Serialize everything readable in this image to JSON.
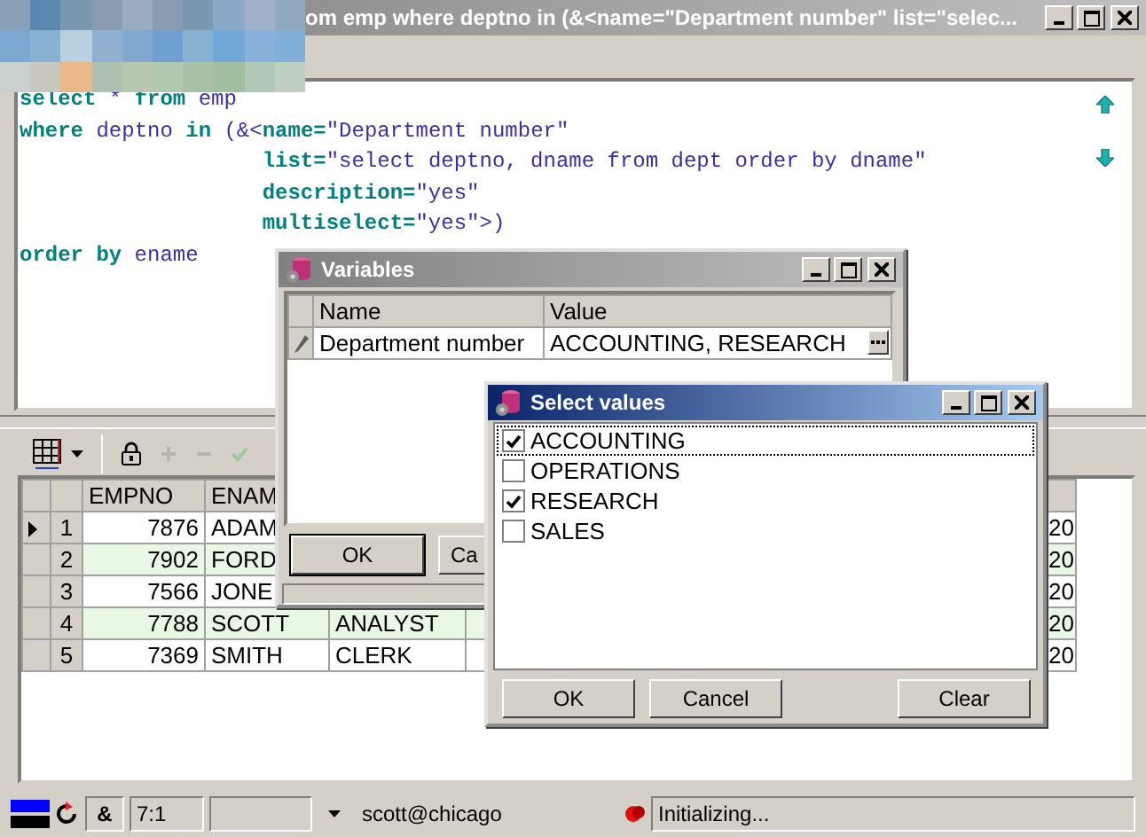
{
  "window": {
    "title": "om emp where deptno in (&<name=\"Department number\" list=\"selec...",
    "active": false
  },
  "editor": {
    "lines": [
      {
        "indented": false,
        "segments": [
          {
            "kind": "keyword",
            "text": "select"
          },
          {
            "kind": "plain",
            "text": " * "
          },
          {
            "kind": "keyword",
            "text": "from"
          },
          {
            "kind": "plain",
            "text": " emp"
          }
        ]
      },
      {
        "indented": false,
        "segments": [
          {
            "kind": "keyword",
            "text": "where"
          },
          {
            "kind": "plain",
            "text": " deptno "
          },
          {
            "kind": "keyword",
            "text": "in"
          },
          {
            "kind": "plain",
            "text": " (&<"
          },
          {
            "kind": "keyword",
            "text": "name="
          },
          {
            "kind": "plain",
            "text": "\"Department number\""
          }
        ]
      },
      {
        "indented": true,
        "segments": [
          {
            "kind": "keyword",
            "text": "list="
          },
          {
            "kind": "plain",
            "text": "\"select deptno, dname from dept order by dname\""
          }
        ]
      },
      {
        "indented": true,
        "segments": [
          {
            "kind": "keyword",
            "text": "description="
          },
          {
            "kind": "plain",
            "text": "\"yes\""
          }
        ]
      },
      {
        "indented": true,
        "segments": [
          {
            "kind": "keyword",
            "text": "multiselect="
          },
          {
            "kind": "plain",
            "text": "\"yes\">)"
          }
        ]
      },
      {
        "indented": false,
        "segments": [
          {
            "kind": "keyword",
            "text": "order by"
          },
          {
            "kind": "plain",
            "text": " ename"
          }
        ]
      }
    ]
  },
  "grid": {
    "columns": [
      "EMPNO",
      "ENAM"
    ],
    "rows": [
      {
        "row_number": "1",
        "empno": "7876",
        "ename": "ADAM",
        "column_7": "20",
        "current": true,
        "highlighted": false
      },
      {
        "row_number": "2",
        "empno": "7902",
        "ename": "FORD",
        "column_7": "20",
        "current": false,
        "highlighted": true
      },
      {
        "row_number": "3",
        "empno": "7566",
        "ename": "JONE",
        "column_7": "20",
        "current": false,
        "highlighted": false
      },
      {
        "row_number": "4",
        "empno": "7788",
        "ename": "SCOTT",
        "job": "ANALYST",
        "column_7": "20",
        "current": false,
        "highlighted": true
      },
      {
        "row_number": "5",
        "empno": "7369",
        "ename": "SMITH",
        "job": "CLERK",
        "column_7": "20",
        "current": false,
        "highlighted": false
      }
    ]
  },
  "variables_dialog": {
    "title": "Variables",
    "active": false,
    "columns": [
      "Name",
      "Value"
    ],
    "rows": [
      {
        "name": "Department number",
        "value": "ACCOUNTING, RESEARCH",
        "editing": true
      }
    ],
    "buttons": [
      "OK",
      "Ca"
    ]
  },
  "select_values_dialog": {
    "title": "Select values",
    "active": true,
    "items": [
      {
        "label": "ACCOUNTING",
        "checked": true,
        "focused": true
      },
      {
        "label": "OPERATIONS",
        "checked": false,
        "focused": false
      },
      {
        "label": "RESEARCH",
        "checked": true,
        "focused": false
      },
      {
        "label": "SALES",
        "checked": false,
        "focused": false
      }
    ],
    "buttons": [
      "OK",
      "Cancel",
      "Clear"
    ]
  },
  "status_bar": {
    "substitution": "&",
    "position": "7:1",
    "connection": "scott@chicago",
    "message": "Initializing..."
  }
}
